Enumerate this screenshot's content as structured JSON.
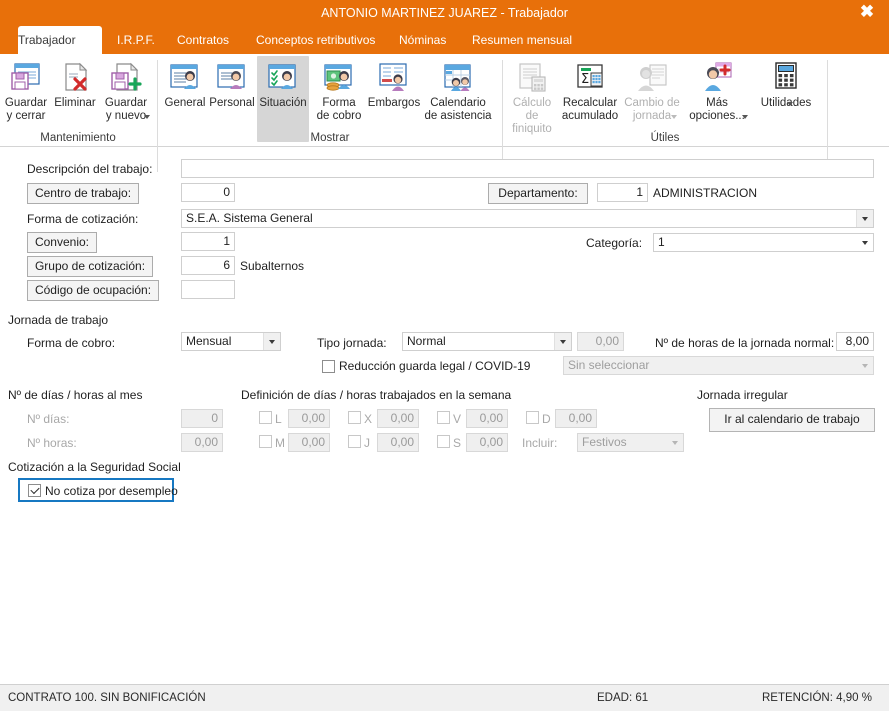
{
  "window": {
    "title": "ANTONIO MARTINEZ JUAREZ - Trabajador",
    "close_icon": "close-icon",
    "accent_color": "#e8700a"
  },
  "tabs": [
    {
      "label": "Trabajador",
      "active": true
    },
    {
      "label": "I.R.P.F.",
      "active": false
    },
    {
      "label": "Contratos",
      "active": false
    },
    {
      "label": "Conceptos retributivos",
      "active": false
    },
    {
      "label": "Nóminas",
      "active": false
    },
    {
      "label": "Resumen mensual",
      "active": false
    }
  ],
  "ribbon": {
    "groups": [
      {
        "name": "Mantenimiento",
        "items": [
          {
            "label": "Guardar\ny cerrar",
            "icon": "save-close-icon",
            "disabled": false,
            "caret": false,
            "selected": false
          },
          {
            "label": "Eliminar",
            "icon": "delete-icon",
            "disabled": false,
            "caret": false,
            "selected": false
          },
          {
            "label": "Guardar\ny nuevo",
            "icon": "save-new-icon",
            "disabled": false,
            "caret": true,
            "selected": false
          }
        ]
      },
      {
        "name": "Mostrar",
        "items": [
          {
            "label": "General",
            "icon": "general-person-icon",
            "disabled": false,
            "caret": false,
            "selected": false
          },
          {
            "label": "Personal",
            "icon": "personal-person-icon",
            "disabled": false,
            "caret": false,
            "selected": false
          },
          {
            "label": "Situación",
            "icon": "situacion-icon",
            "disabled": false,
            "caret": false,
            "selected": true
          },
          {
            "label": "Forma\nde cobro",
            "icon": "forma-cobro-icon",
            "disabled": false,
            "caret": false,
            "selected": false
          },
          {
            "label": "Embargos",
            "icon": "embargos-icon",
            "disabled": false,
            "caret": false,
            "selected": false
          },
          {
            "label": "Calendario\nde asistencia",
            "icon": "calendario-asistencia-icon",
            "disabled": false,
            "caret": false,
            "selected": false
          }
        ]
      },
      {
        "name": "Útiles",
        "items": [
          {
            "label": "Cálculo de\nfiniquito",
            "icon": "calculo-finiquito-icon",
            "disabled": true,
            "caret": false,
            "selected": false
          },
          {
            "label": "Recalcular\nacumulado",
            "icon": "recalcular-acumulado-icon",
            "disabled": false,
            "caret": false,
            "selected": false
          },
          {
            "label": "Cambio de\njornada",
            "icon": "cambio-jornada-icon",
            "disabled": true,
            "caret": true,
            "selected": false
          },
          {
            "label": "Más\nopciones...",
            "icon": "mas-opciones-icon",
            "disabled": false,
            "caret": true,
            "selected": false
          }
        ]
      },
      {
        "name": "",
        "items": [
          {
            "label": "Utilidades",
            "icon": "utilidades-calculator-icon",
            "disabled": false,
            "caret": true,
            "selected": false
          }
        ]
      }
    ]
  },
  "form": {
    "descripcion_label": "Descripción del trabajo:",
    "descripcion_value": "",
    "centro_trabajo_button": "Centro de trabajo:",
    "centro_trabajo_value": "0",
    "departamento_button": "Departamento:",
    "departamento_value": "1",
    "departamento_name": "ADMINISTRACION",
    "forma_cotizacion_label": "Forma de cotización:",
    "forma_cotizacion_value": "S.E.A. Sistema General",
    "convenio_button": "Convenio:",
    "convenio_value": "1",
    "categoria_label": "Categoría:",
    "categoria_value": "1",
    "grupo_cotizacion_button": "Grupo de cotización:",
    "grupo_cotizacion_value": "6",
    "grupo_cotizacion_name": "Subalternos",
    "codigo_ocupacion_button": "Código de ocupación:",
    "codigo_ocupacion_value": ""
  },
  "jornada": {
    "section_title": "Jornada de trabajo",
    "forma_cobro_label": "Forma de cobro:",
    "forma_cobro_value": "Mensual",
    "tipo_jornada_label": "Tipo jornada:",
    "tipo_jornada_value": "Normal",
    "tipo_jornada_num": "0,00",
    "horas_normal_label": "Nº de horas de la jornada normal:",
    "horas_normal_value": "8,00",
    "reduccion_label": "Reducción guarda legal / COVID-19",
    "reduccion_checked": false,
    "reduccion_combo_value": "Sin seleccionar"
  },
  "dias_mes": {
    "section_title": "Nº de días / horas al mes",
    "dias_label": "Nº días:",
    "dias_value": "0",
    "horas_label": "Nº horas:",
    "horas_value": "0,00"
  },
  "semana": {
    "section_title": "Definición de días / horas trabajados en la semana",
    "days": [
      {
        "code": "L",
        "value": "0,00",
        "checked": false
      },
      {
        "code": "M",
        "value": "0,00",
        "checked": false
      },
      {
        "code": "X",
        "value": "0,00",
        "checked": false
      },
      {
        "code": "J",
        "value": "0,00",
        "checked": false
      },
      {
        "code": "V",
        "value": "0,00",
        "checked": false
      },
      {
        "code": "S",
        "value": "0,00",
        "checked": false
      },
      {
        "code": "D",
        "value": "0,00",
        "checked": false
      }
    ],
    "incluir_label": "Incluir:",
    "incluir_value": "Festivos"
  },
  "jornada_irregular": {
    "section_title": "Jornada irregular",
    "button_label": "Ir al calendario de trabajo"
  },
  "cotizacion": {
    "section_title": "Cotización a la Seguridad Social",
    "no_cotiza_label": "No cotiza por desempleo",
    "no_cotiza_checked": true,
    "focus_color": "#1778c2"
  },
  "statusbar": {
    "contrato": "CONTRATO 100.  SIN BONIFICACIÓN",
    "edad": "EDAD: 61",
    "retencion": "RETENCIÓN: 4,90 %"
  }
}
